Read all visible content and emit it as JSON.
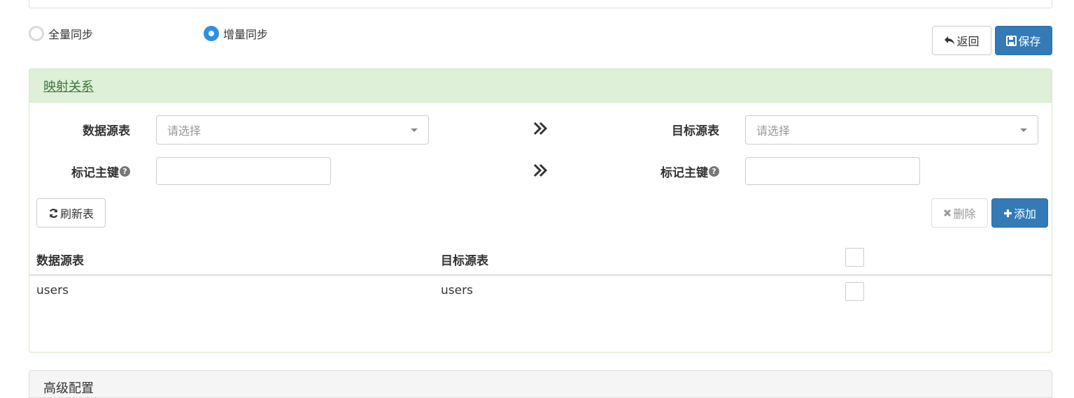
{
  "sync_mode": {
    "options": [
      {
        "label": "全量同步",
        "selected": false
      },
      {
        "label": "增量同步",
        "selected": true
      }
    ]
  },
  "toolbar": {
    "back_label": "返回",
    "save_label": "保存"
  },
  "mapping": {
    "title": "映射关系",
    "source_table_label": "数据源表",
    "target_table_label": "目标源表",
    "source_select_placeholder": "请选择",
    "target_select_placeholder": "请选择",
    "source_pk_label": "标记主键",
    "target_pk_label": "标记主键",
    "refresh_label": "刷新表",
    "delete_label": "删除",
    "add_label": "添加",
    "table": {
      "headers": [
        "数据源表",
        "目标源表"
      ],
      "rows": [
        {
          "source": "users",
          "target": "users",
          "checked": false
        }
      ]
    }
  },
  "advanced": {
    "title": "高级配置"
  },
  "colors": {
    "primary": "#337ab7",
    "panel_success_bg": "#dff0d8",
    "panel_success_text": "#3c763d",
    "radio_active": "#2f8fe6"
  }
}
